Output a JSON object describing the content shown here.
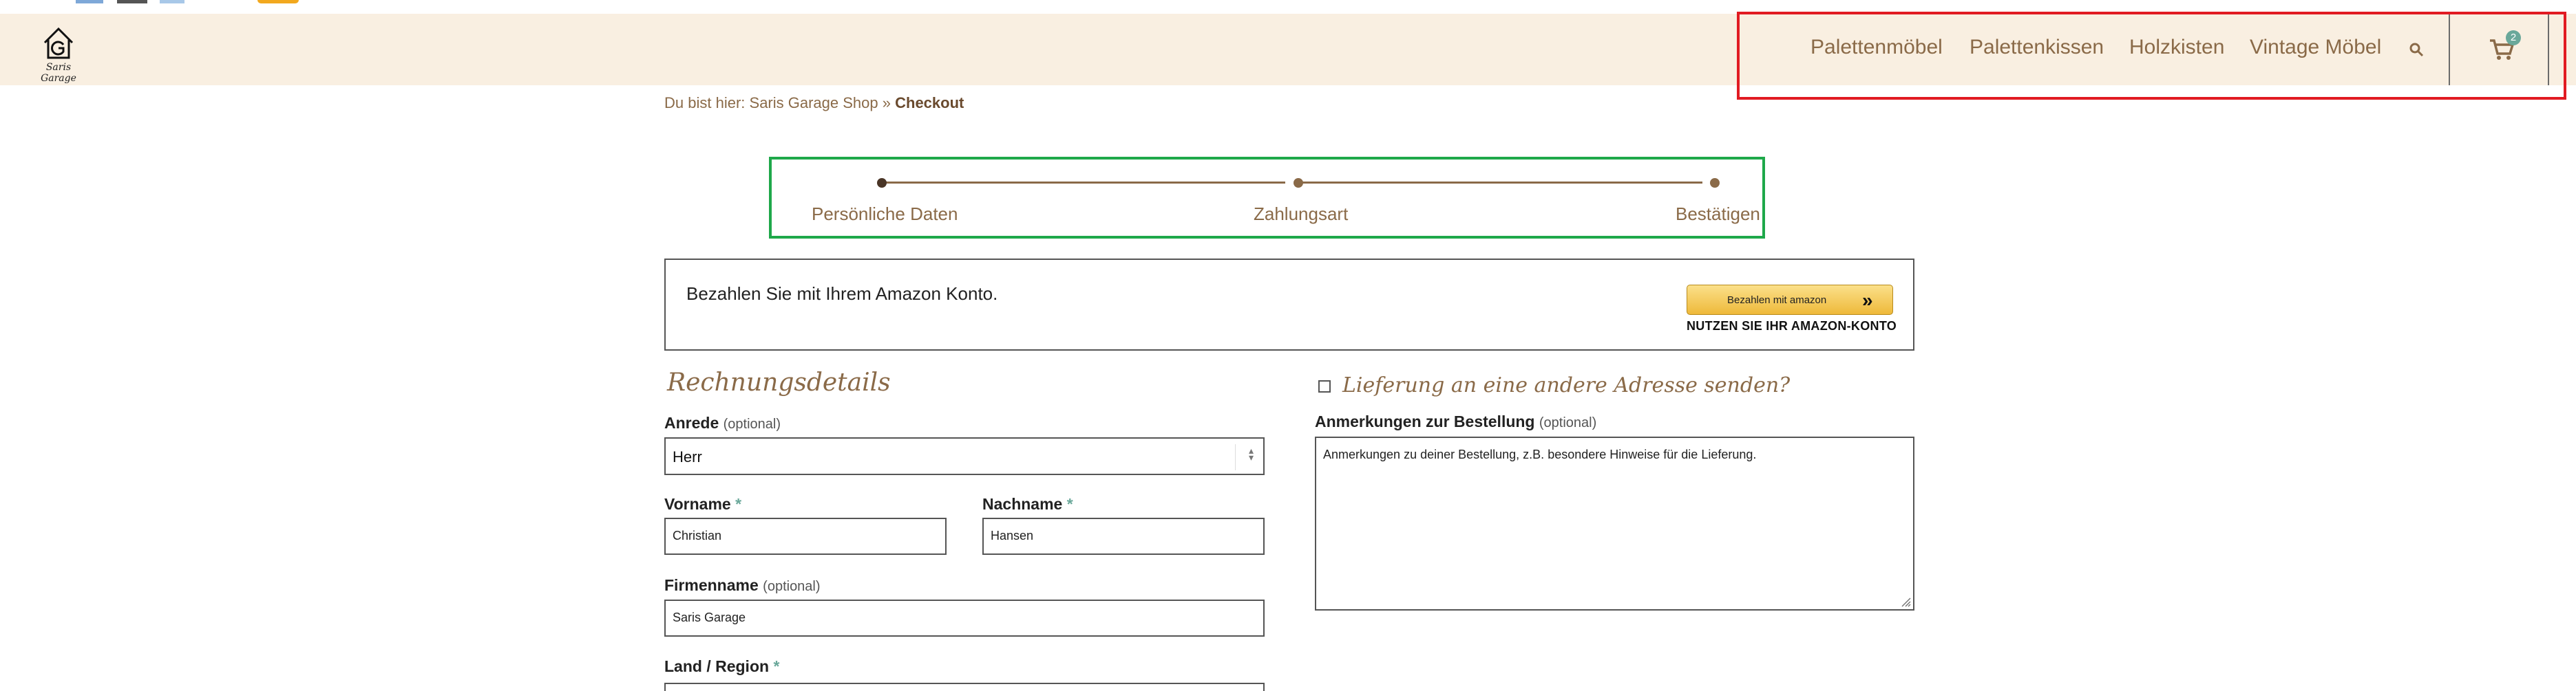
{
  "header": {
    "logo_text": "Saris Garage",
    "nav": [
      "Palettenmöbel",
      "Palettenkissen",
      "Holzkisten",
      "Vintage Möbel"
    ],
    "cart_count": "2"
  },
  "breadcrumb": {
    "prefix": "Du bist hier:",
    "shop": "Saris Garage Shop",
    "separator": "»",
    "current": "Checkout"
  },
  "steps": [
    "Persönliche Daten",
    "Zahlungsart",
    "Bestätigen"
  ],
  "amazon": {
    "text": "Bezahlen Sie mit Ihrem Amazon Konto.",
    "button_label": "Bezahlen mit amazon",
    "sub_label": "NUTZEN SIE IHR AMAZON-KONTO"
  },
  "billing": {
    "title": "Rechnungsdetails",
    "anrede_label": "Anrede",
    "anrede_value": "Herr",
    "vorname_label": "Vorname",
    "vorname_value": "Christian",
    "nachname_label": "Nachname",
    "nachname_value": "Hansen",
    "firma_label": "Firmenname",
    "firma_value": "Saris Garage",
    "land_label": "Land / Region",
    "optional": "(optional)",
    "required": "*"
  },
  "shipping": {
    "title": "Lieferung an eine andere Adresse senden?",
    "notes_label": "Anmerkungen zur Bestellung",
    "notes_placeholder": "Anmerkungen zu deiner Bestellung, z.B. besondere Hinweise für die Lieferung."
  },
  "colors": {
    "header_bg": "#f9efe1",
    "accent_brown": "#8a6a48",
    "highlight_red": "#e11b22",
    "highlight_green": "#1ea84a"
  },
  "icons": [
    "logo-house-icon",
    "search-icon",
    "cart-icon",
    "checkbox-icon",
    "select-arrows-icon"
  ]
}
